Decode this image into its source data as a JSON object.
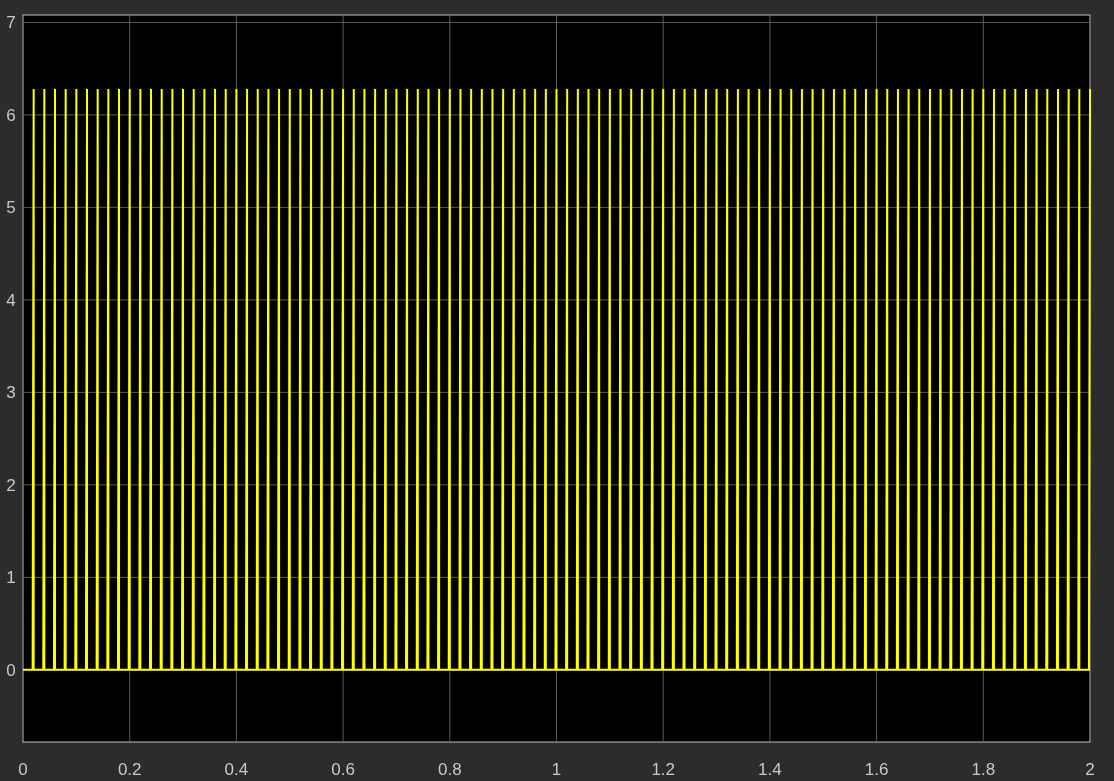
{
  "chart_data": {
    "type": "line",
    "grid": true,
    "xlim": [
      0,
      2
    ],
    "ylim": [
      -0.78,
      7.08
    ],
    "xticks": [
      {
        "value": 0,
        "label": "0"
      },
      {
        "value": 0.2,
        "label": "0.2"
      },
      {
        "value": 0.4,
        "label": "0.4"
      },
      {
        "value": 0.6,
        "label": "0.6"
      },
      {
        "value": 0.8,
        "label": "0.8"
      },
      {
        "value": 1,
        "label": "1"
      },
      {
        "value": 1.2,
        "label": "1.2"
      },
      {
        "value": 1.4,
        "label": "1.4"
      },
      {
        "value": 1.6,
        "label": "1.6"
      },
      {
        "value": 1.8,
        "label": "1.8"
      },
      {
        "value": 2,
        "label": "2"
      }
    ],
    "yticks": [
      {
        "value": 0,
        "label": "0"
      },
      {
        "value": 1,
        "label": "1"
      },
      {
        "value": 2,
        "label": "2"
      },
      {
        "value": 3,
        "label": "3"
      },
      {
        "value": 4,
        "label": "4"
      },
      {
        "value": 5,
        "label": "5"
      },
      {
        "value": 6,
        "label": "6"
      },
      {
        "value": 7,
        "label": "7"
      }
    ],
    "x": [
      0,
      0.018,
      0.02,
      0.02,
      0.038,
      0.04,
      0.04,
      0.058,
      0.06,
      0.06,
      0.078,
      0.08,
      0.08,
      0.098,
      0.1,
      0.1,
      0.118,
      0.12,
      0.12,
      0.138,
      0.14,
      0.14,
      0.158,
      0.16,
      0.16,
      0.178,
      0.18,
      0.18,
      0.198,
      0.2,
      0.2,
      0.218,
      0.22,
      0.22,
      0.238,
      0.24,
      0.24,
      0.258,
      0.26,
      0.26,
      0.278,
      0.28,
      0.28,
      0.298,
      0.3,
      0.3,
      0.318,
      0.32,
      0.32,
      0.338,
      0.34,
      0.34,
      0.358,
      0.36,
      0.36,
      0.378,
      0.38,
      0.38,
      0.398,
      0.4,
      0.4,
      0.418,
      0.42,
      0.42,
      0.438,
      0.44,
      0.44,
      0.458,
      0.46,
      0.46,
      0.478,
      0.48,
      0.48,
      0.498,
      0.5,
      0.5,
      0.518,
      0.52,
      0.52,
      0.538,
      0.54,
      0.54,
      0.558,
      0.56,
      0.56,
      0.578,
      0.58,
      0.58,
      0.598,
      0.6,
      0.6,
      0.618,
      0.62,
      0.62,
      0.638,
      0.64,
      0.64,
      0.658,
      0.66,
      0.66,
      0.678,
      0.68,
      0.68,
      0.698,
      0.7,
      0.7,
      0.718,
      0.72,
      0.72,
      0.738,
      0.74,
      0.74,
      0.758,
      0.76,
      0.76,
      0.778,
      0.78,
      0.78,
      0.798,
      0.8,
      0.8,
      0.818,
      0.82,
      0.82,
      0.838,
      0.84,
      0.84,
      0.858,
      0.86,
      0.86,
      0.878,
      0.88,
      0.88,
      0.898,
      0.9,
      0.9,
      0.918,
      0.92,
      0.92,
      0.938,
      0.94,
      0.94,
      0.958,
      0.96,
      0.96,
      0.978,
      0.98,
      0.98,
      0.998,
      1,
      1,
      1.018,
      1.02,
      1.02,
      1.038,
      1.04,
      1.04,
      1.058,
      1.06,
      1.06,
      1.078,
      1.08,
      1.08,
      1.098,
      1.1,
      1.1,
      1.118,
      1.12,
      1.12,
      1.138,
      1.14,
      1.14,
      1.158,
      1.16,
      1.16,
      1.178,
      1.18,
      1.18,
      1.198,
      1.2,
      1.2,
      1.218,
      1.22,
      1.22,
      1.238,
      1.24,
      1.24,
      1.258,
      1.26,
      1.26,
      1.278,
      1.28,
      1.28,
      1.298,
      1.3,
      1.3,
      1.318,
      1.32,
      1.32,
      1.338,
      1.34,
      1.34,
      1.358,
      1.36,
      1.36,
      1.378,
      1.38,
      1.38,
      1.398,
      1.4,
      1.4,
      1.418,
      1.42,
      1.42,
      1.438,
      1.44,
      1.44,
      1.458,
      1.46,
      1.46,
      1.478,
      1.48,
      1.48,
      1.498,
      1.5,
      1.5,
      1.518,
      1.52,
      1.52,
      1.538,
      1.54,
      1.54,
      1.558,
      1.56,
      1.56,
      1.578,
      1.58,
      1.58,
      1.598,
      1.6,
      1.6,
      1.618,
      1.62,
      1.62,
      1.638,
      1.64,
      1.64,
      1.658,
      1.66,
      1.66,
      1.678,
      1.68,
      1.68,
      1.698,
      1.7,
      1.7,
      1.718,
      1.72,
      1.72,
      1.738,
      1.74,
      1.74,
      1.758,
      1.76,
      1.76,
      1.778,
      1.78,
      1.78,
      1.798,
      1.8,
      1.8,
      1.818,
      1.82,
      1.82,
      1.838,
      1.84,
      1.84,
      1.858,
      1.86,
      1.86,
      1.878,
      1.88,
      1.88,
      1.898,
      1.9,
      1.9,
      1.918,
      1.92,
      1.92,
      1.938,
      1.94,
      1.94,
      1.958,
      1.96,
      1.96,
      1.978,
      1.98,
      1.98,
      1.998,
      2
    ],
    "series": [
      {
        "color": "#ffff00",
        "values": [
          0,
          0,
          6.28,
          0,
          0,
          6.28,
          0,
          0,
          6.28,
          0,
          0,
          6.28,
          0,
          0,
          6.28,
          0,
          0,
          6.28,
          0,
          0,
          6.28,
          0,
          0,
          6.28,
          0,
          0,
          6.28,
          0,
          0,
          6.28,
          0,
          0,
          6.28,
          0,
          0,
          6.28,
          0,
          0,
          6.28,
          0,
          0,
          6.28,
          0,
          0,
          6.28,
          0,
          0,
          6.28,
          0,
          0,
          6.28,
          0,
          0,
          6.28,
          0,
          0,
          6.28,
          0,
          0,
          6.28,
          0,
          0,
          6.28,
          0,
          0,
          6.28,
          0,
          0,
          6.28,
          0,
          0,
          6.28,
          0,
          0,
          6.28,
          0,
          0,
          6.28,
          0,
          0,
          6.28,
          0,
          0,
          6.28,
          0,
          0,
          6.28,
          0,
          0,
          6.28,
          0,
          0,
          6.28,
          0,
          0,
          6.28,
          0,
          0,
          6.28,
          0,
          0,
          6.28,
          0,
          0,
          6.28,
          0,
          0,
          6.28,
          0,
          0,
          6.28,
          0,
          0,
          6.28,
          0,
          0,
          6.28,
          0,
          0,
          6.28,
          0,
          0,
          6.28,
          0,
          0,
          6.28,
          0,
          0,
          6.28,
          0,
          0,
          6.28,
          0,
          0,
          6.28,
          0,
          0,
          6.28,
          0,
          0,
          6.28,
          0,
          0,
          6.28,
          0,
          0,
          6.28,
          0,
          0,
          6.28,
          0,
          0,
          6.28,
          0,
          0,
          6.28,
          0,
          0,
          6.28,
          0,
          0,
          6.28,
          0,
          0,
          6.28,
          0,
          0,
          6.28,
          0,
          0,
          6.28,
          0,
          0,
          6.28,
          0,
          0,
          6.28,
          0,
          0,
          6.28,
          0,
          0,
          6.28,
          0,
          0,
          6.28,
          0,
          0,
          6.28,
          0,
          0,
          6.28,
          0,
          0,
          6.28,
          0,
          0,
          6.28,
          0,
          0,
          6.28,
          0,
          0,
          6.28,
          0,
          0,
          6.28,
          0,
          0,
          6.28,
          0,
          0,
          6.28,
          0,
          0,
          6.28,
          0,
          0,
          6.28,
          0,
          0,
          6.28,
          0,
          0,
          6.28,
          0,
          0,
          6.28,
          0,
          0,
          6.28,
          0,
          0,
          6.28,
          0,
          0,
          6.28,
          0,
          0,
          6.28,
          0,
          0,
          6.28,
          0,
          0,
          6.28,
          0,
          0,
          6.28,
          0,
          0,
          6.28,
          0,
          0,
          6.28,
          0,
          0,
          6.28,
          0,
          0,
          6.28,
          0,
          0,
          6.28,
          0,
          0,
          6.28,
          0,
          0,
          6.28,
          0,
          0,
          6.28,
          0,
          0,
          6.28,
          0,
          0,
          6.28,
          0,
          0,
          6.28,
          0,
          0,
          6.28,
          0,
          0,
          6.28,
          0,
          0,
          6.28,
          0,
          0,
          6.28,
          0,
          0,
          6.28,
          0,
          0,
          6.28
        ]
      }
    ]
  }
}
